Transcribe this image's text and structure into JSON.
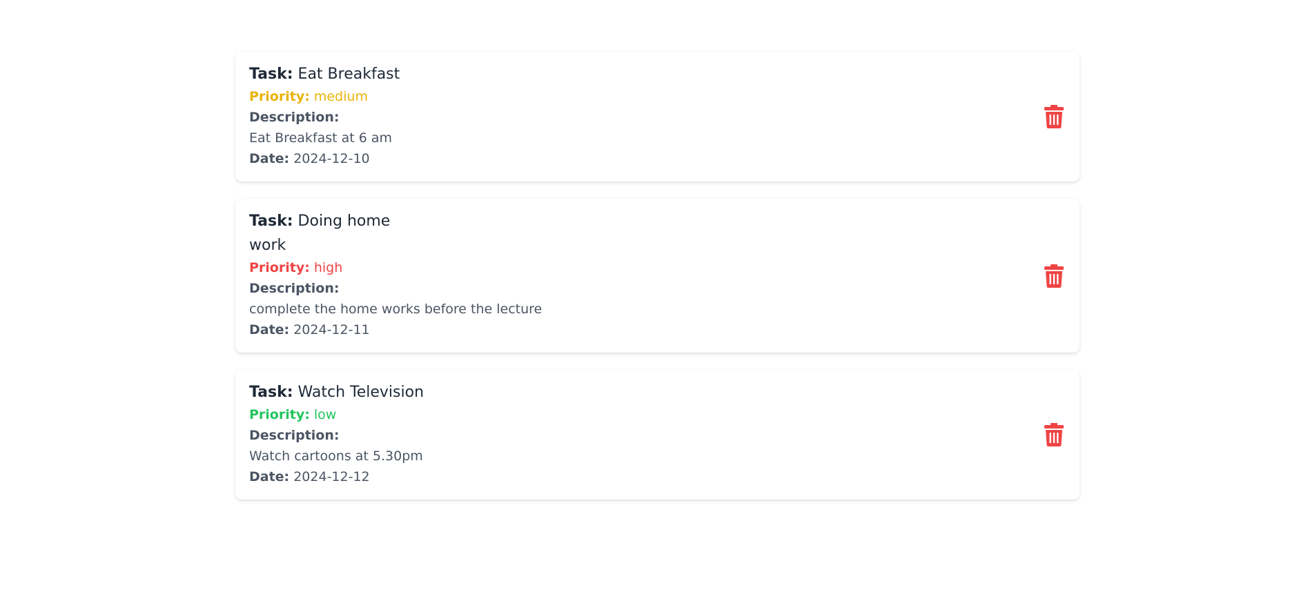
{
  "labels": {
    "task": "Task:",
    "priority": "Priority:",
    "description": "Description:",
    "date": "Date:"
  },
  "priority_colors": {
    "medium": "#eab308",
    "high": "#ef4444",
    "low": "#22c55e"
  },
  "delete_icon": "trash-icon",
  "delete_color": "#ef4444",
  "tasks": [
    {
      "title": "Eat Breakfast",
      "priority": "medium",
      "description": "Eat Breakfast at 6 am",
      "date": "2024-12-10"
    },
    {
      "title": "Doing home work",
      "priority": "high",
      "description": "complete the home works before the lecture",
      "date": "2024-12-11"
    },
    {
      "title": "Watch Television",
      "priority": "low",
      "description": "Watch cartoons at 5.30pm",
      "date": "2024-12-12"
    }
  ]
}
